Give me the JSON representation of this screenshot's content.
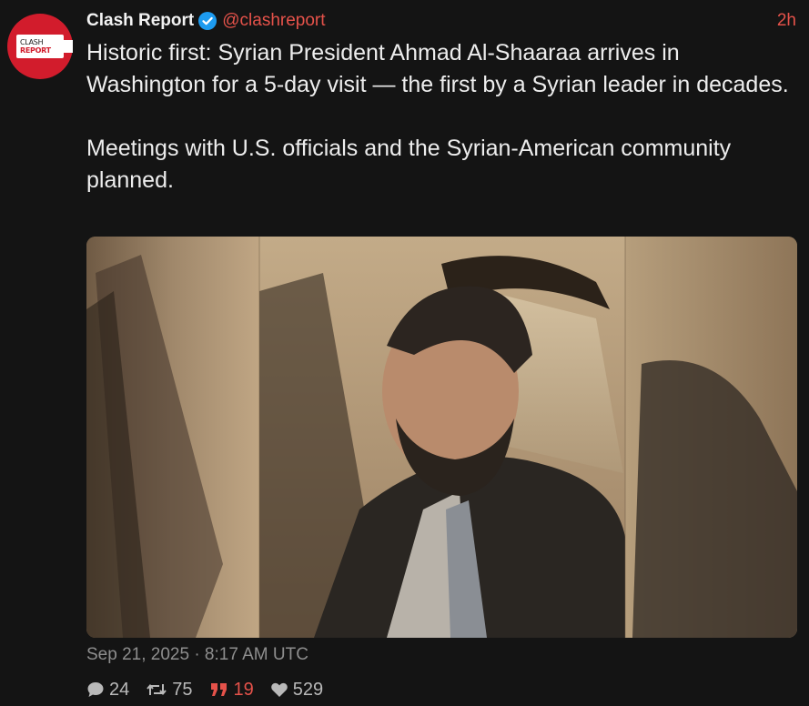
{
  "author": {
    "name": "Clash Report",
    "handle": "@clashreport",
    "avatar_line1": "CLASH",
    "avatar_line2": "REPORT"
  },
  "time_ago": "2h",
  "text": "Historic first: Syrian President Ahmad Al-Shaaraa arrives in Washington for a 5-day visit — the first by a Syrian leader in decades.\n\nMeetings with U.S. officials and the Syrian-American community planned.",
  "timestamp": "Sep 21, 2025 · 8:17 AM UTC",
  "stats": {
    "replies": "24",
    "reposts": "75",
    "quotes": "19",
    "likes": "529"
  },
  "icons": {
    "verified": "verified-badge-icon",
    "reply": "speech-bubble-icon",
    "repost": "repost-arrows-icon",
    "quote": "quote-marks-icon",
    "like": "heart-icon"
  },
  "colors": {
    "background": "#141414",
    "accent": "#e5524a",
    "verified": "#1d9bf0",
    "avatar": "#d21c2c"
  }
}
